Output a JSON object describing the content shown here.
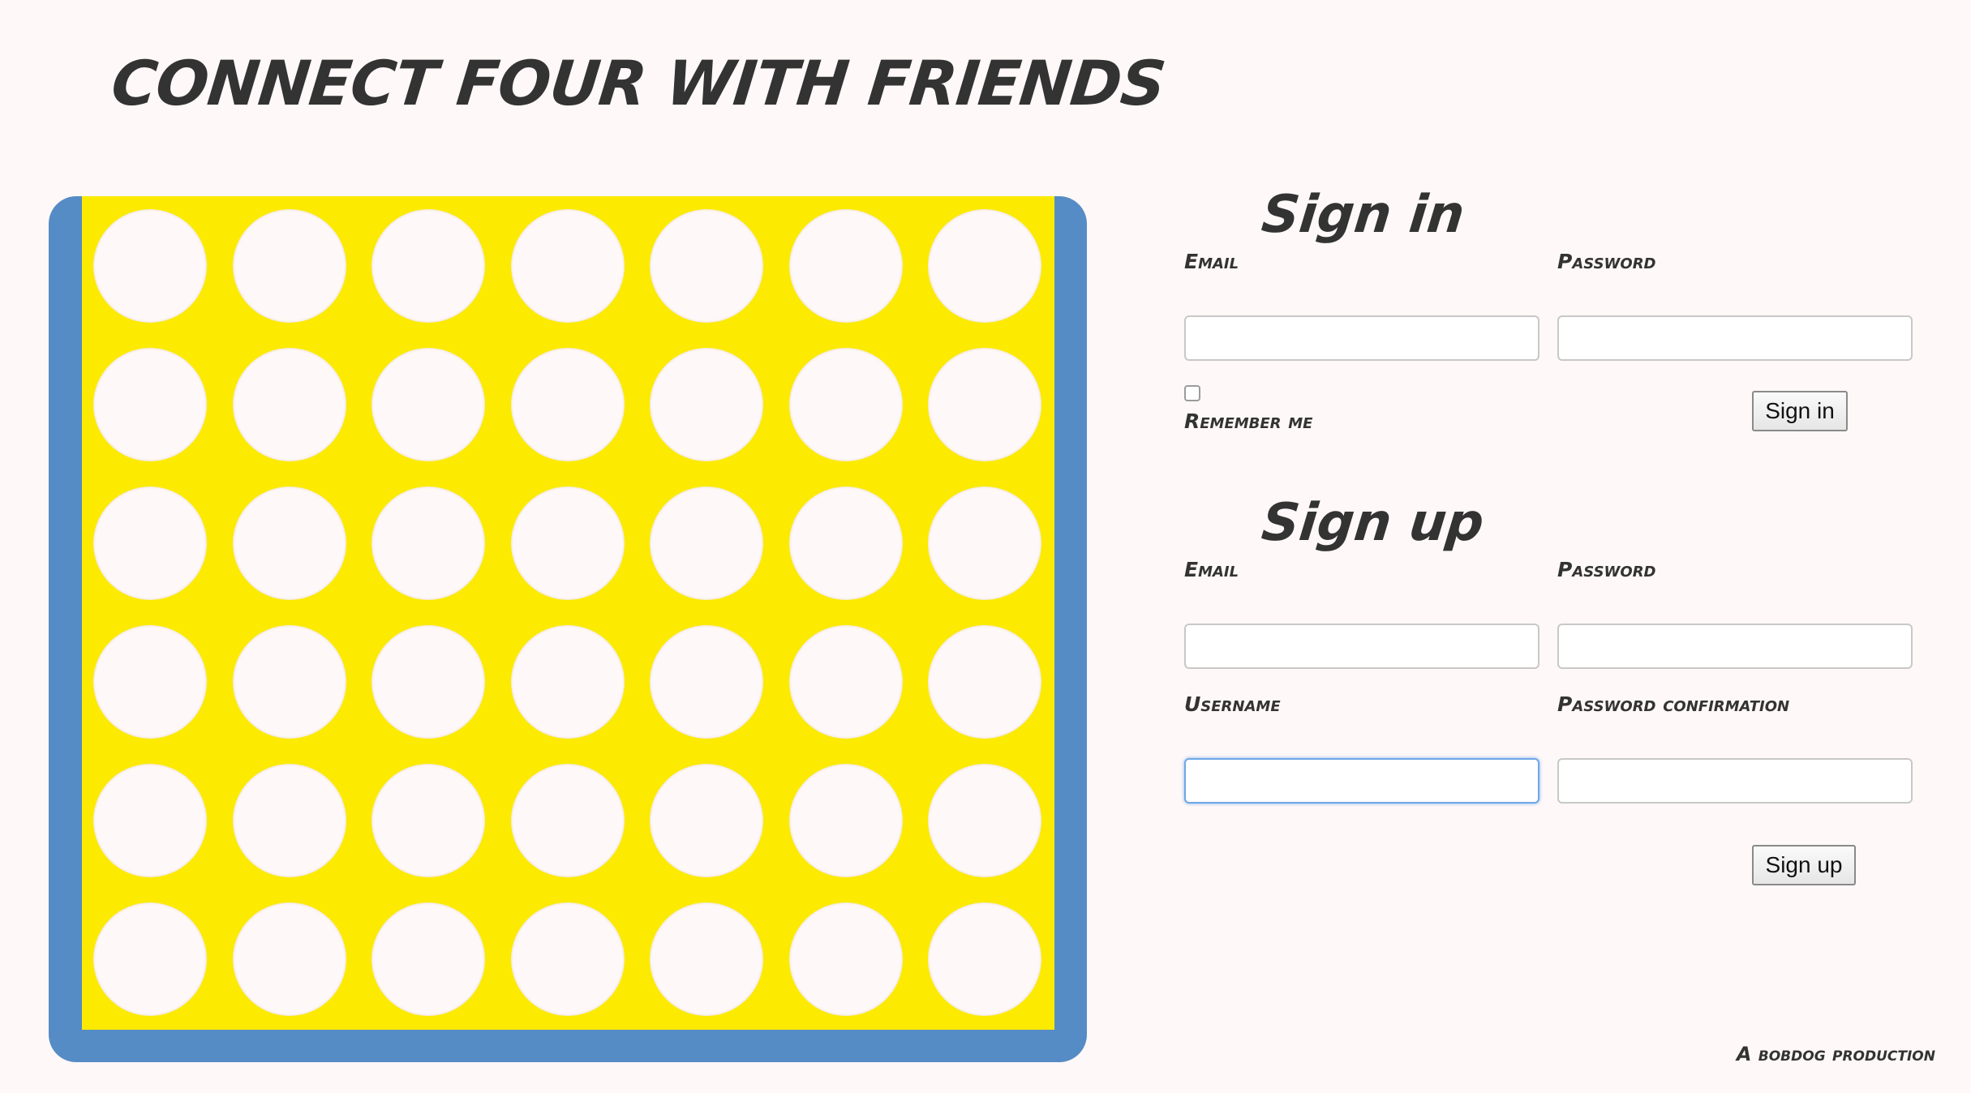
{
  "header": {
    "title": "CONNECT FOUR WITH FRIENDS"
  },
  "colors": {
    "page_background": "#fff8f8",
    "board_frame": "#568cc5",
    "board_face": "#fcea00",
    "empty_slot": "#fff8f8",
    "text": "#333333",
    "focus_ring": "#6fa8e6"
  },
  "board": {
    "columns": 7,
    "rows": 6,
    "slots": "all empty"
  },
  "sign_in": {
    "heading": "Sign in",
    "email_label": "Email",
    "email_value": "",
    "password_label": "Password",
    "password_value": "",
    "remember_label": "Remember me",
    "remember_checked": false,
    "submit_label": "Sign in"
  },
  "sign_up": {
    "heading": "Sign up",
    "email_label": "Email",
    "email_value": "",
    "password_label": "Password",
    "password_value": "",
    "username_label": "Username",
    "username_value": "",
    "password_confirmation_label": "Password confirmation",
    "password_confirmation_value": "",
    "submit_label": "Sign up"
  },
  "footer": {
    "credit": "A bobdog production"
  }
}
